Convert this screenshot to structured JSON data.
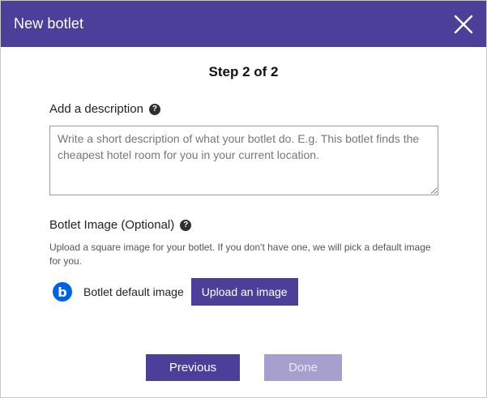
{
  "dialog": {
    "title": "New botlet",
    "close_icon": "close-icon"
  },
  "step": "Step 2 of 2",
  "description": {
    "label": "Add a description",
    "help_icon": "?",
    "value": "",
    "placeholder": "Write a short description of what your botlet do. E.g. This botlet finds the cheapest hotel room for you in your current location."
  },
  "image": {
    "label": "Botlet Image (Optional)",
    "help_icon": "?",
    "hint": "Upload a square image for your botlet. If you don't have one, we will pick a default image for you.",
    "default_logo_letter": "b",
    "default_label": "Botlet default image",
    "upload_label": "Upload an image"
  },
  "footer": {
    "previous_label": "Previous",
    "done_label": "Done",
    "done_enabled": false
  },
  "colors": {
    "accent": "#4b3f9a",
    "accent_disabled": "#a7a0cf",
    "logo_blue": "#0063e5"
  }
}
